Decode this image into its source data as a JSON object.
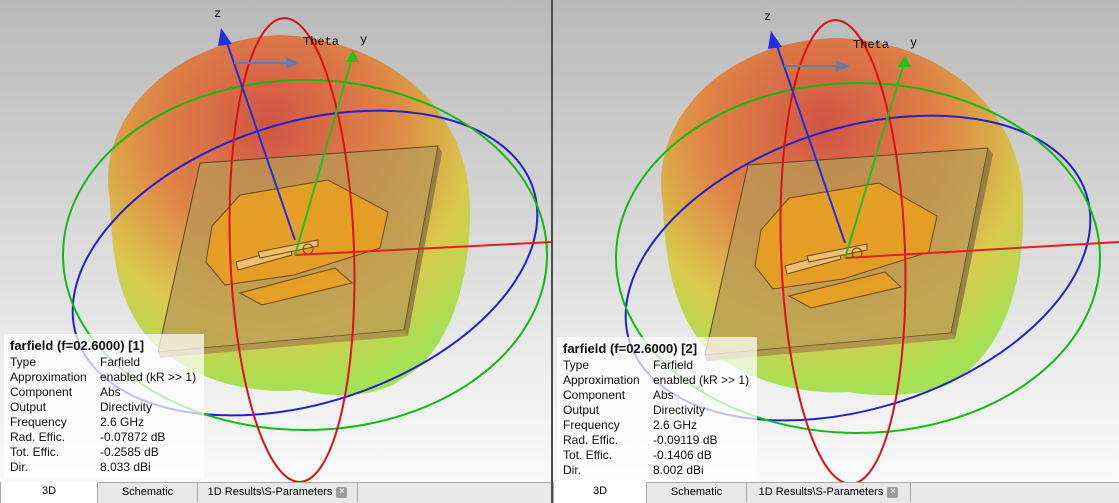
{
  "axes": {
    "z": "z",
    "y": "y",
    "theta": "Theta"
  },
  "colors": {
    "axis_x": "#e02020",
    "axis_y": "#20c020",
    "axis_z": "#2030e0",
    "circle_red": "#dd1111",
    "circle_green": "#11bb11",
    "circle_blue": "#2222cc",
    "pattern_top": "#d24a3a",
    "pattern_bottom": "#9ee048",
    "substrate": "#b89a55",
    "patch": "#e89e20"
  },
  "panes": [
    {
      "info": {
        "title": "farfield (f=02.6000) [1]",
        "rows": [
          {
            "k": "Type",
            "v": "Farfield"
          },
          {
            "k": "Approximation",
            "v": "enabled (kR >> 1)"
          },
          {
            "k": "Component",
            "v": "Abs"
          },
          {
            "k": "Output",
            "v": "Directivity"
          },
          {
            "k": "Frequency",
            "v": "2.6 GHz"
          },
          {
            "k": "Rad. Effic.",
            "v": "-0.07872 dB"
          },
          {
            "k": "Tot. Effic.",
            "v": "-0.2585 dB"
          },
          {
            "k": "Dir.",
            "v": "8.033 dBi"
          }
        ]
      },
      "tabs": {
        "t3d": "3D",
        "schematic": "Schematic",
        "results": "1D Results\\S-Parameters",
        "close": "×"
      }
    },
    {
      "info": {
        "title": "farfield (f=02.6000) [2]",
        "rows": [
          {
            "k": "Type",
            "v": "Farfield"
          },
          {
            "k": "Approximation",
            "v": "enabled (kR >> 1)"
          },
          {
            "k": "Component",
            "v": "Abs"
          },
          {
            "k": "Output",
            "v": "Directivity"
          },
          {
            "k": "Frequency",
            "v": "2.6 GHz"
          },
          {
            "k": "Rad. Effic.",
            "v": "-0.09119 dB"
          },
          {
            "k": "Tot. Effic.",
            "v": "-0.1406 dB"
          },
          {
            "k": "Dir.",
            "v": "8.002 dBi"
          }
        ]
      },
      "tabs": {
        "t3d": "3D",
        "schematic": "Schematic",
        "results": "1D Results\\S-Parameters",
        "close": "×"
      }
    }
  ]
}
